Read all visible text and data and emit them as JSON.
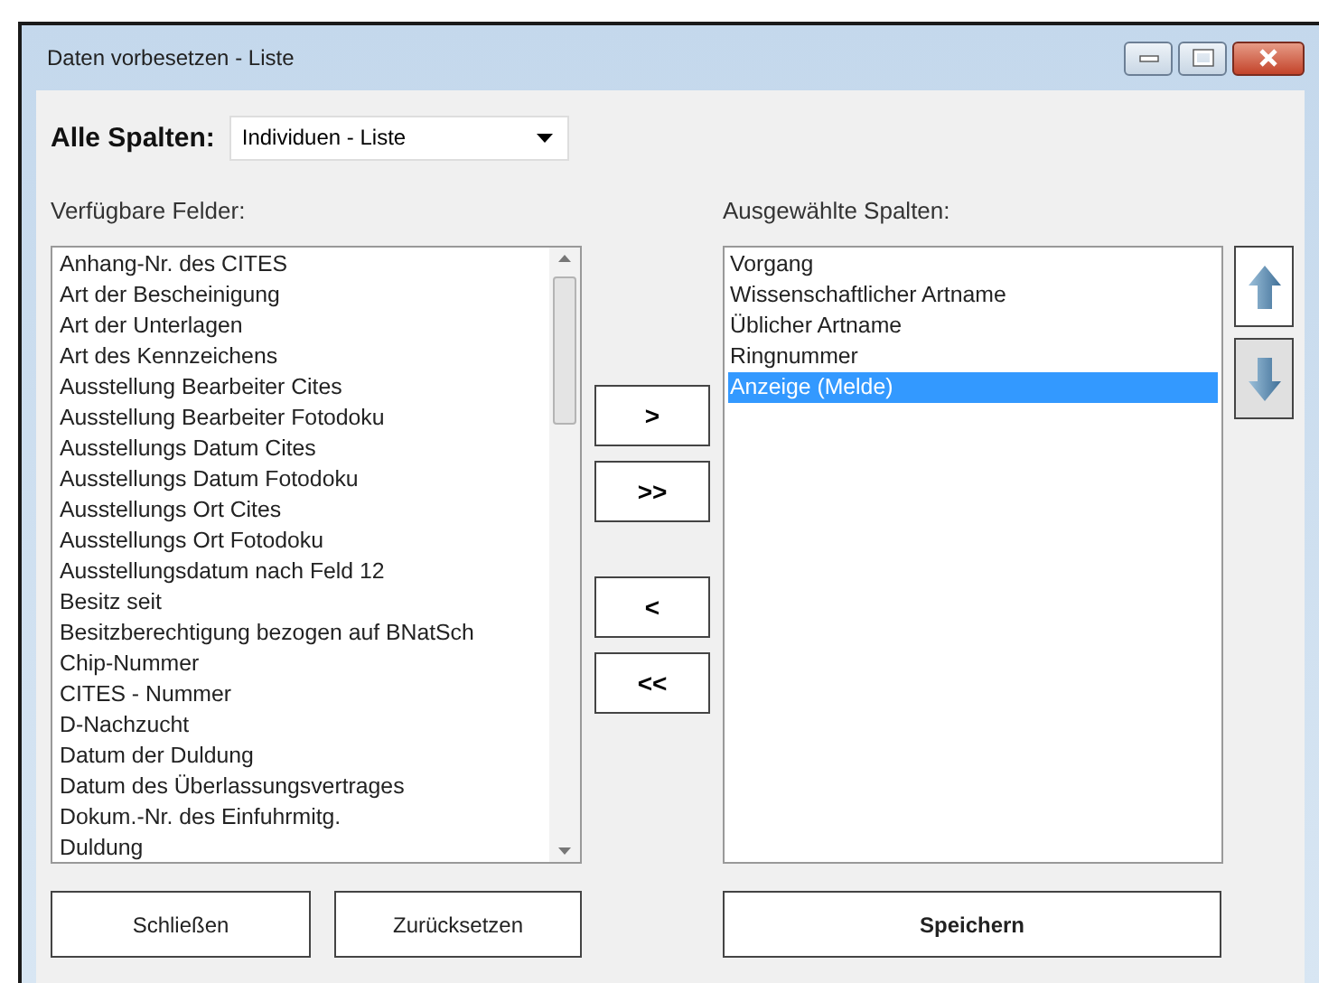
{
  "window": {
    "title": "Daten vorbesetzen - Liste"
  },
  "all_columns": {
    "label": "Alle Spalten:",
    "value": "Individuen - Liste"
  },
  "available_fields": {
    "label": "Verfügbare Felder:",
    "items": [
      "Anhang-Nr. des CITES",
      "Art der Bescheinigung",
      "Art der Unterlagen",
      "Art des Kennzeichens",
      "Ausstellung Bearbeiter Cites",
      "Ausstellung Bearbeiter Fotodoku",
      "Ausstellungs Datum Cites",
      "Ausstellungs Datum Fotodoku",
      "Ausstellungs Ort Cites",
      "Ausstellungs Ort Fotodoku",
      "Ausstellungsdatum nach Feld 12",
      "Besitz seit",
      "Besitzberechtigung bezogen auf BNatSch",
      "Chip-Nummer",
      "CITES - Nummer",
      "D-Nachzucht",
      "Datum der Duldung",
      "Datum des Überlassungsvertrages",
      "Dokum.-Nr. des Einfuhrmitg.",
      "Duldung"
    ]
  },
  "add_buttons": [
    ">",
    ">>"
  ],
  "remove_buttons": [
    "<",
    "<<"
  ],
  "selected_columns": {
    "label": "Ausgewählte Spalten:",
    "items": [
      {
        "text": "Vorgang",
        "selected": false
      },
      {
        "text": "Wissenschaftlicher Artname",
        "selected": false
      },
      {
        "text": "Üblicher Artname",
        "selected": false
      },
      {
        "text": "Ringnummer",
        "selected": false
      },
      {
        "text": "Anzeige (Melde)",
        "selected": true
      }
    ]
  },
  "footer_buttons": [
    {
      "label": "Schließen",
      "kind": "normal"
    },
    {
      "label": "Zurücksetzen",
      "kind": "normal"
    },
    {
      "label": "Speichern",
      "kind": "primary"
    }
  ]
}
